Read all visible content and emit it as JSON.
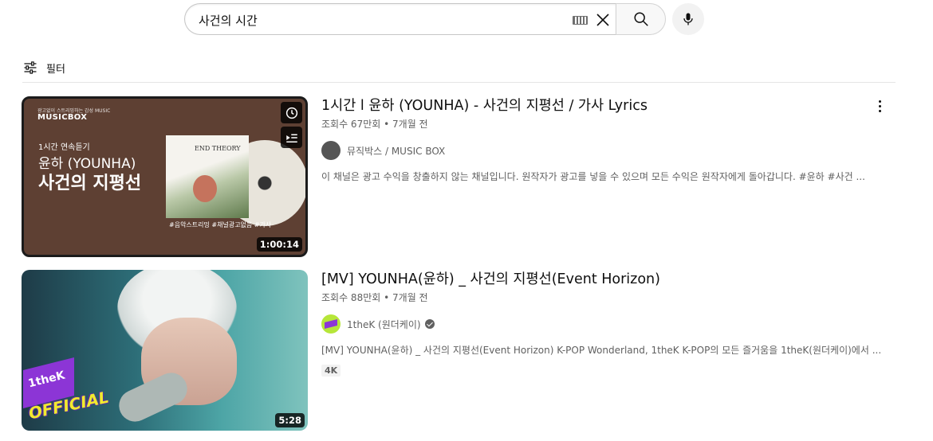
{
  "search": {
    "query": "사건의 시간"
  },
  "filter": {
    "label": "필터"
  },
  "results": [
    {
      "title": "1시간 l 윤하 (YOUNHA) - 사건의 지평선 / 가사 Lyrics",
      "views": "조회수 67만회",
      "age": "7개월 전",
      "channel": "뮤직박스 / MUSIC BOX",
      "description": "이 채널은 광고 수익을 창출하지 않는 채널입니다. 원작자가 광고를 넣을 수 있으며 모든 수익은 원작자에게 돌아갑니다. #윤하 #사건 ...",
      "duration": "1:00:14",
      "thumbnail": {
        "top_text": "광고없이 스트리밍하는 감성 MUSIC",
        "brand": "MUSICBOX",
        "line1": "1시간 연속듣기",
        "line2": "윤하 (YOUNHA)",
        "line3": "사건의 지평선",
        "album": "END THEORY",
        "tags": "#음악스트리밍 #채널광고없음 #가사"
      }
    },
    {
      "title": "[MV] YOUNHA(윤하) _ 사건의 지평선(Event Horizon)",
      "views": "조회수 88만회",
      "age": "7개월 전",
      "channel": "1theK (원더케이)",
      "verified": true,
      "description": "[MV] YOUNHA(윤하) _ 사건의 지평선(Event Horizon) K-POP Wonderland, 1theK K-POP의 모든 즐거움을 1theK(원더케이)에서 ...",
      "badge": "4K",
      "duration": "5:28",
      "thumbnail": {
        "logo": "1theK",
        "official": "OFFICIAL"
      }
    }
  ],
  "meta_separator": "•"
}
